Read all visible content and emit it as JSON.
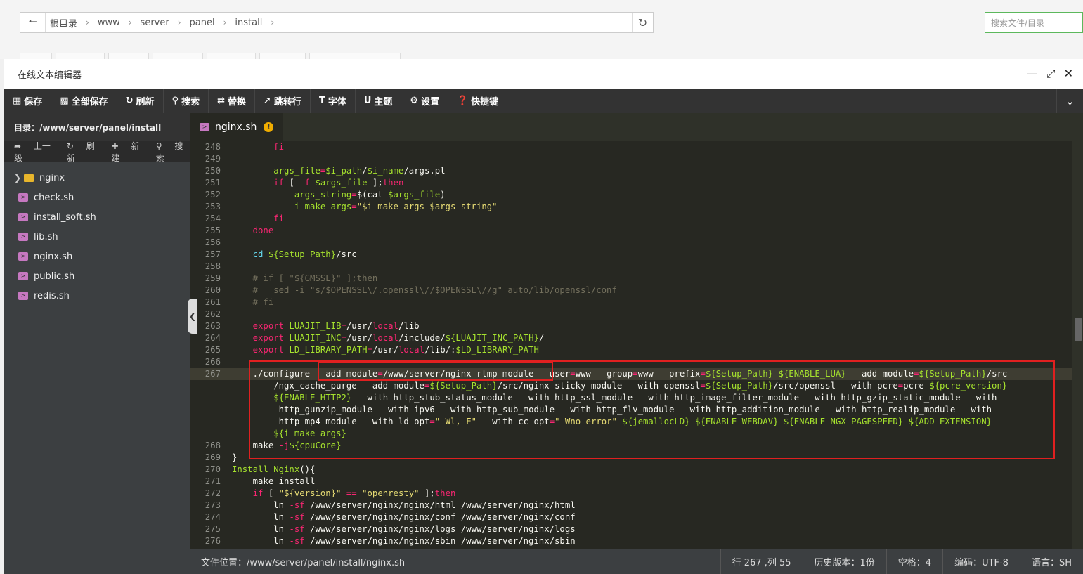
{
  "address_bar": {
    "crumbs": [
      "根目录",
      "www",
      "server",
      "panel",
      "install"
    ],
    "search_placeholder": "搜索文件/目录"
  },
  "window": {
    "title": "在线文本编辑器"
  },
  "toolbar": {
    "save": "保存",
    "save_all": "全部保存",
    "refresh": "刷新",
    "search": "搜索",
    "replace": "替换",
    "goto_line": "跳转行",
    "font": "字体",
    "theme": "主题",
    "settings": "设置",
    "shortcuts": "快捷键"
  },
  "sidebar": {
    "path": "目录：/www/server/panel/install",
    "up": "上一级",
    "refresh": "刷新",
    "new": "新建",
    "search": "搜索",
    "items": [
      {
        "name": "nginx",
        "type": "folder"
      },
      {
        "name": "check.sh",
        "type": "file"
      },
      {
        "name": "install_soft.sh",
        "type": "file"
      },
      {
        "name": "lib.sh",
        "type": "file"
      },
      {
        "name": "nginx.sh",
        "type": "file"
      },
      {
        "name": "public.sh",
        "type": "file"
      },
      {
        "name": "redis.sh",
        "type": "file"
      }
    ]
  },
  "editor": {
    "tab": "nginx.sh",
    "tab_warning": "!"
  },
  "statusbar": {
    "path": "文件位置：/www/server/panel/install/nginx.sh",
    "position": "行 267 ,列 55",
    "history": "历史版本：1份",
    "spaces": "空格：4",
    "encoding": "编码：UTF-8",
    "language": "语言：SH"
  },
  "colors": {
    "editor_bg": "#272822",
    "highlight_box": "#e02020",
    "keyword": "#f92672",
    "string": "#e6db74",
    "variable": "#a6e22e"
  }
}
